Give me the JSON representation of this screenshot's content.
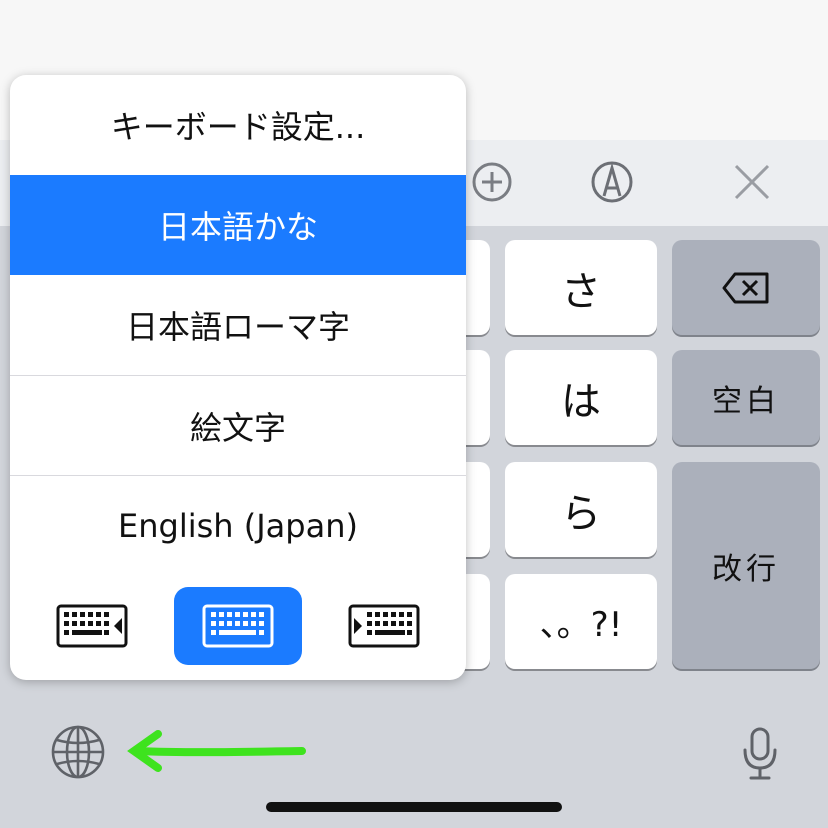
{
  "menu": {
    "items": [
      {
        "label": "キーボード設定..."
      },
      {
        "label": "日本語かな",
        "selected": true
      },
      {
        "label": "日本語ローマ字"
      },
      {
        "label": "絵文字"
      },
      {
        "label": "English (Japan)"
      }
    ],
    "modes": [
      "left-handed-keyboard-icon",
      "full-keyboard-icon",
      "right-handed-keyboard-icon"
    ],
    "selected_mode": "full-keyboard-icon"
  },
  "keyboard": {
    "keys": [
      "さ",
      "は",
      "ら",
      "、。?!"
    ],
    "space_label": "空白",
    "return_label": "改行"
  },
  "toolbar": {
    "icons": [
      "add-circle-icon",
      "handwriting-icon",
      "close-icon"
    ]
  },
  "annotation": {
    "arrow_color": "#3ee31e"
  },
  "colors": {
    "accent": "#1b7bff",
    "keyboard_bg": "#d2d5db",
    "dark_key": "#abb0bb"
  }
}
